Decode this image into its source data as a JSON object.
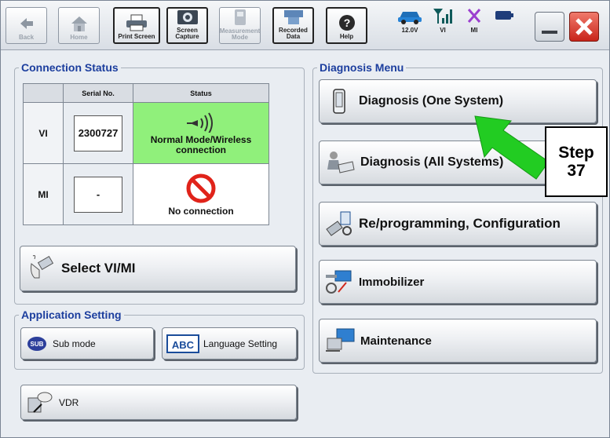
{
  "toolbar": {
    "back": "Back",
    "home": "Home",
    "print_screen": "Print Screen",
    "screen_capture_1": "Screen",
    "screen_capture_2": "Capture",
    "measurement_1": "Measurement",
    "measurement_2": "Mode",
    "recorded_1": "Recorded",
    "recorded_2": "Data",
    "help": "Help"
  },
  "status_bar": {
    "voltage": "12.0V",
    "vi": "VI",
    "mi": "MI"
  },
  "connection_status": {
    "title": "Connection Status",
    "col_serial": "Serial No.",
    "col_status": "Status",
    "rows": [
      {
        "label": "VI",
        "serial": "2300727",
        "status": "Normal Mode/Wireless connection"
      },
      {
        "label": "MI",
        "serial": "-",
        "status": "No connection"
      }
    ],
    "select_button": "Select VI/MI"
  },
  "application_setting": {
    "title": "Application Setting",
    "sub_mode": "Sub mode",
    "sub_icon_text": "SUB",
    "language": "Language Setting",
    "language_icon_text": "ABC"
  },
  "vdr": {
    "label": "VDR"
  },
  "diagnosis_menu": {
    "title": "Diagnosis Menu",
    "items": [
      "Diagnosis (One System)",
      "Diagnosis (All Systems)",
      "Re/programming, Configuration",
      "Immobilizer",
      "Maintenance"
    ]
  },
  "annotation": {
    "step_word": "Step",
    "step_number": "37",
    "arrow_color": "#22cc22"
  }
}
